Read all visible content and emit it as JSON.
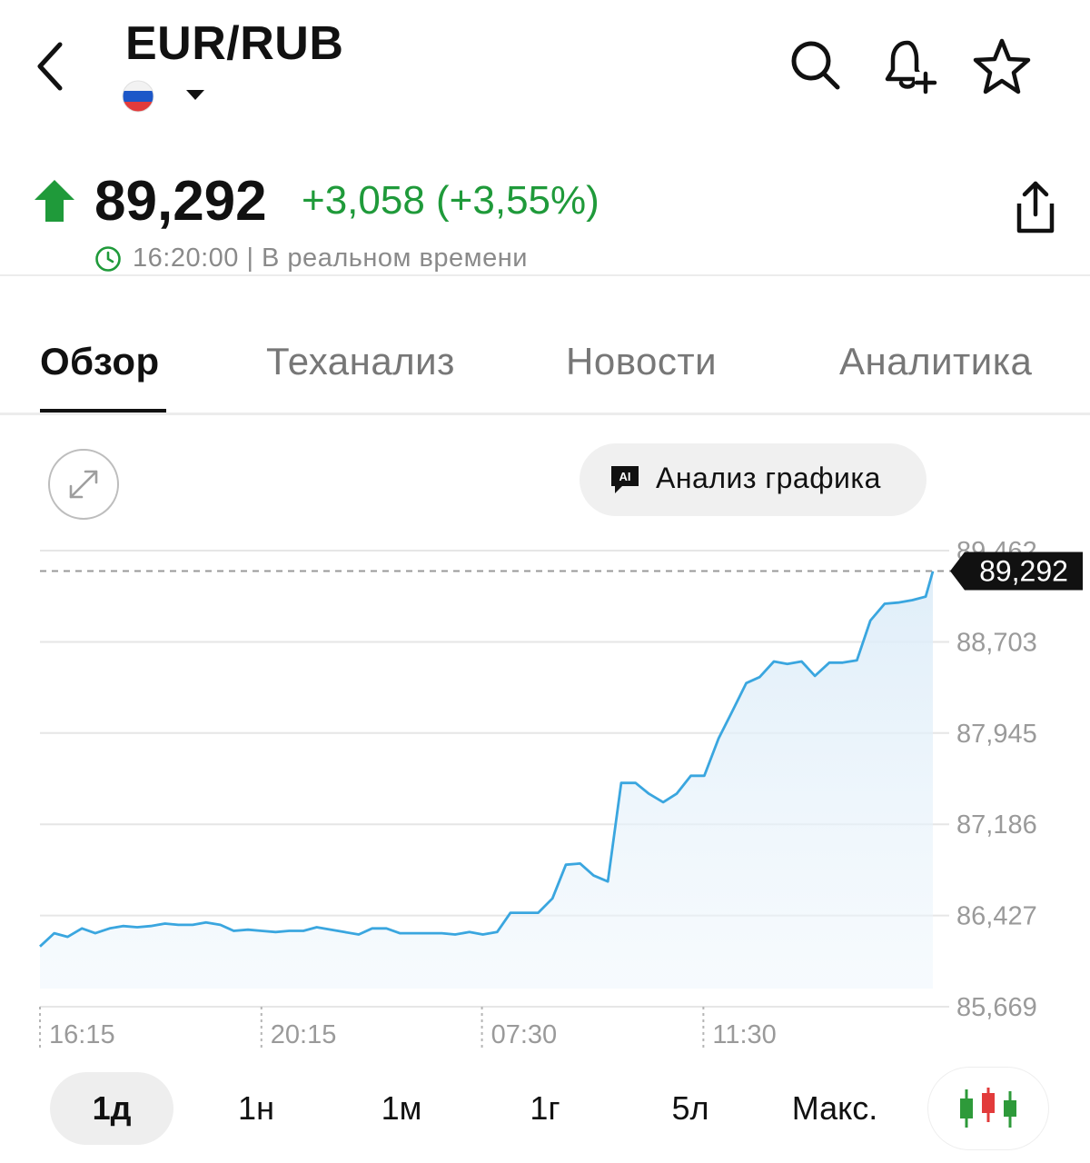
{
  "header": {
    "title": "EUR/RUB",
    "back_icon": "chevron-left-icon",
    "flag_icon": "russia-flag-icon",
    "dropdown_icon": "caret-down-icon",
    "actions": [
      "search-icon",
      "bell-plus-icon",
      "star-icon"
    ]
  },
  "quote": {
    "price": "89,292",
    "change": "+3,058 (+3,55%)",
    "timestamp": "16:20:00 | В реальном времени",
    "trend_color": "#1f9a3a"
  },
  "tabs": [
    {
      "label": "Обзор",
      "active": true
    },
    {
      "label": "Теханализ",
      "active": false
    },
    {
      "label": "Новости",
      "active": false
    },
    {
      "label": "Аналитика",
      "active": false
    }
  ],
  "chart_tools": {
    "ai_badge": "AI",
    "ai_label": "Анализ графика"
  },
  "periods": [
    {
      "label": "1д",
      "active": true
    },
    {
      "label": "1н",
      "active": false
    },
    {
      "label": "1м",
      "active": false
    },
    {
      "label": "1г",
      "active": false
    },
    {
      "label": "5л",
      "active": false
    },
    {
      "label": "Макс.",
      "active": false
    }
  ],
  "chart_data": {
    "type": "area",
    "line_color": "#3aa6df",
    "y_ticks": [
      "89,462",
      "88,703",
      "87,945",
      "87,186",
      "86,427",
      "85,669"
    ],
    "y_tick_values": [
      89.462,
      88.703,
      87.945,
      87.186,
      86.427,
      85.669
    ],
    "ylim": [
      85.669,
      89.462
    ],
    "x_ticks": [
      "16:15",
      "20:15",
      "07:30",
      "11:30"
    ],
    "x_tick_positions": [
      0,
      0.248,
      0.495,
      0.743
    ],
    "current_label": "89,292",
    "current_value": 89.292,
    "points": [
      [
        0.0,
        86.17
      ],
      [
        0.016,
        86.28
      ],
      [
        0.031,
        86.25
      ],
      [
        0.047,
        86.32
      ],
      [
        0.062,
        86.28
      ],
      [
        0.078,
        86.32
      ],
      [
        0.093,
        86.34
      ],
      [
        0.109,
        86.33
      ],
      [
        0.124,
        86.34
      ],
      [
        0.14,
        86.36
      ],
      [
        0.155,
        86.35
      ],
      [
        0.171,
        86.35
      ],
      [
        0.186,
        86.37
      ],
      [
        0.202,
        86.35
      ],
      [
        0.217,
        86.3
      ],
      [
        0.233,
        86.31
      ],
      [
        0.248,
        86.3
      ],
      [
        0.264,
        86.29
      ],
      [
        0.279,
        86.3
      ],
      [
        0.295,
        86.3
      ],
      [
        0.31,
        86.33
      ],
      [
        0.326,
        86.31
      ],
      [
        0.341,
        86.29
      ],
      [
        0.357,
        86.27
      ],
      [
        0.372,
        86.32
      ],
      [
        0.388,
        86.32
      ],
      [
        0.403,
        86.28
      ],
      [
        0.419,
        86.28
      ],
      [
        0.434,
        86.28
      ],
      [
        0.45,
        86.28
      ],
      [
        0.465,
        86.27
      ],
      [
        0.481,
        86.29
      ],
      [
        0.496,
        86.27
      ],
      [
        0.512,
        86.29
      ],
      [
        0.527,
        86.45
      ],
      [
        0.543,
        86.45
      ],
      [
        0.558,
        86.45
      ],
      [
        0.574,
        86.57
      ],
      [
        0.589,
        86.85
      ],
      [
        0.605,
        86.86
      ],
      [
        0.62,
        86.76
      ],
      [
        0.636,
        86.71
      ],
      [
        0.651,
        87.53
      ],
      [
        0.667,
        87.53
      ],
      [
        0.682,
        87.44
      ],
      [
        0.698,
        87.37
      ],
      [
        0.713,
        87.44
      ],
      [
        0.729,
        87.59
      ],
      [
        0.744,
        87.59
      ],
      [
        0.76,
        87.9
      ],
      [
        0.775,
        88.12
      ],
      [
        0.791,
        88.36
      ],
      [
        0.806,
        88.41
      ],
      [
        0.822,
        88.54
      ],
      [
        0.837,
        88.52
      ],
      [
        0.853,
        88.54
      ],
      [
        0.868,
        88.42
      ],
      [
        0.884,
        88.53
      ],
      [
        0.899,
        88.53
      ],
      [
        0.915,
        88.55
      ],
      [
        0.93,
        88.88
      ],
      [
        0.946,
        89.02
      ],
      [
        0.961,
        89.03
      ],
      [
        0.977,
        89.05
      ],
      [
        0.992,
        89.08
      ],
      [
        1.0,
        89.29
      ]
    ]
  }
}
